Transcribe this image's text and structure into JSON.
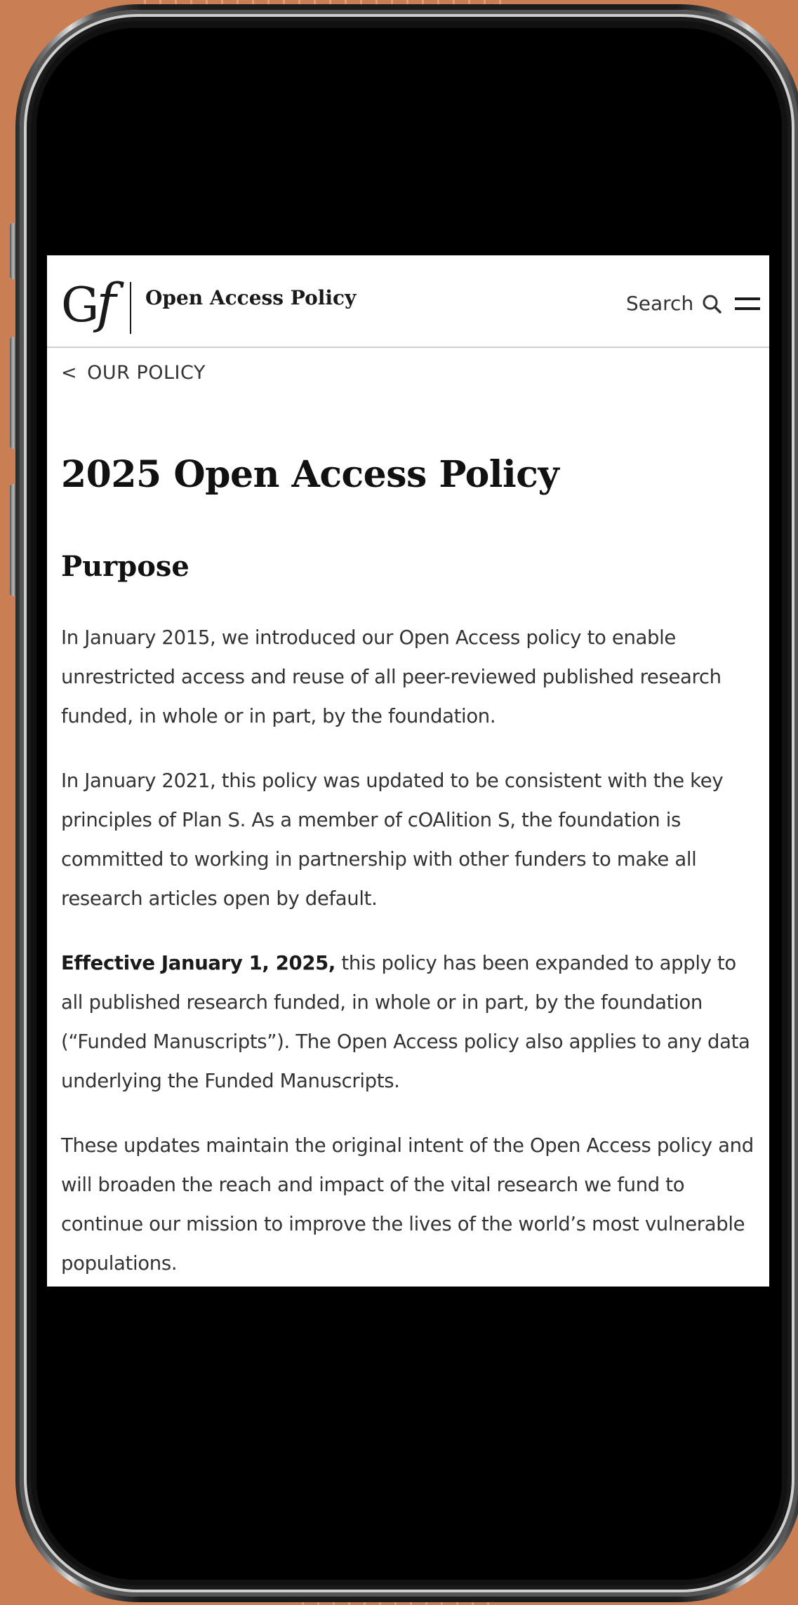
{
  "header": {
    "logo_text": "Gf",
    "site_title": "Open Access Policy",
    "search_label": "Search",
    "search_icon": "search-icon",
    "menu_icon": "hamburger-menu-icon"
  },
  "breadcrumb": {
    "chevron": "<",
    "label": "OUR POLICY"
  },
  "page": {
    "title": "2025 Open Access Policy",
    "section_heading": "Purpose",
    "paragraphs": [
      {
        "text": "In January 2015, we introduced our Open Access policy to enable unrestricted access and reuse of all peer-reviewed published research funded, in whole or in part, by the foundation."
      },
      {
        "text": "In January 2021, this policy was updated to be consistent with the key principles of Plan S. As a member of cOAlition S, the foundation is committed to working in partnership with other funders to make all research articles open by default."
      },
      {
        "bold_lead": "Effective January 1, 2025,",
        "text": " this policy has been expanded to apply to all published research funded, in whole or in part, by the foundation (“Funded Manuscripts”). The Open Access policy also applies to any data underlying the Funded Manuscripts."
      },
      {
        "text": "These updates maintain the original intent of the Open Access policy and will broaden the reach and impact of the vital research we fund to continue our mission to improve the lives of the world’s most vulnerable populations."
      }
    ]
  },
  "colors": {
    "background": "#c97f53",
    "page_bg": "#ffffff",
    "text": "#333333"
  }
}
